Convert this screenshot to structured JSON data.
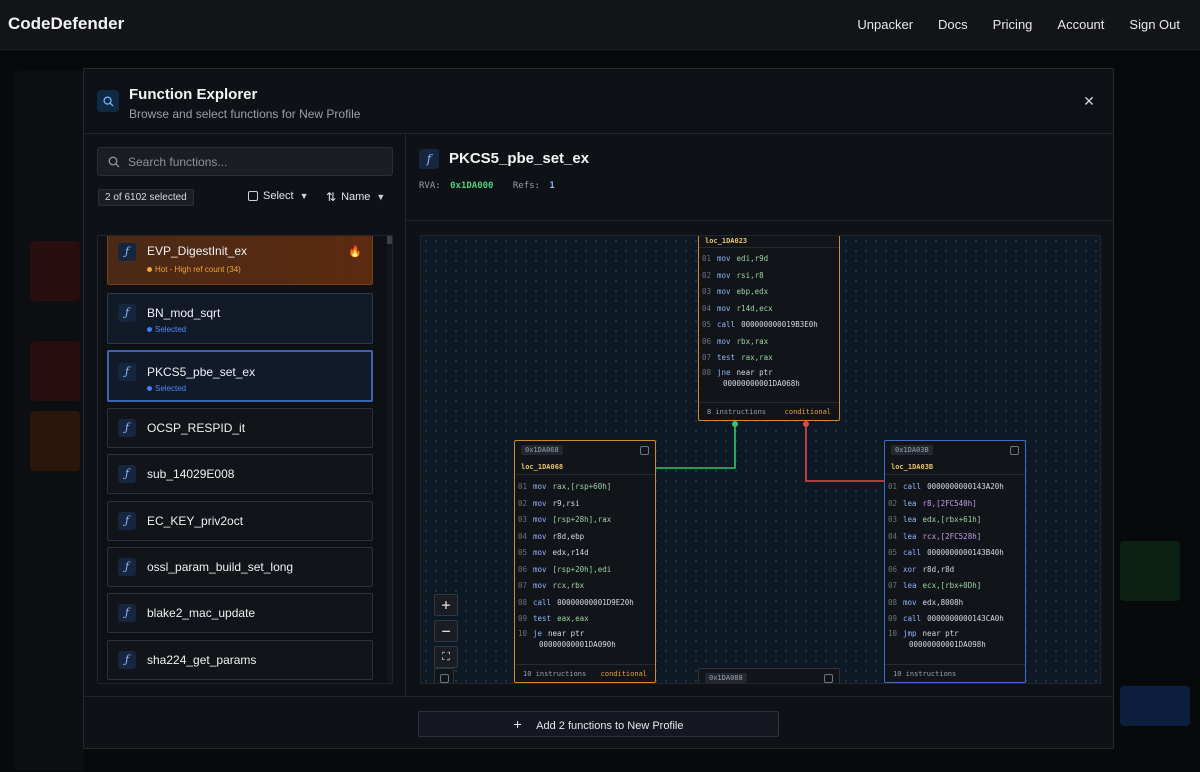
{
  "app": {
    "brand": "CodeDefender",
    "nav": [
      "Unpacker",
      "Docs",
      "Pricing",
      "Account",
      "Sign Out"
    ]
  },
  "modal": {
    "title": "Function Explorer",
    "subtitle": "Browse and select functions for New Profile",
    "close_glyph": "✕"
  },
  "left": {
    "search_placeholder": "Search functions...",
    "count": "2 of 6102 selected",
    "select_label": "Select",
    "sort_label": "Name",
    "items": [
      {
        "name": "EVP_DigestInit_ex",
        "status": "Hot - High ref count (34)",
        "kind": "hot",
        "flame": "🔥"
      },
      {
        "name": "BN_mod_sqrt",
        "status": "Selected",
        "kind": "selected"
      },
      {
        "name": "PKCS5_pbe_set_ex",
        "status": "Selected",
        "kind": "active"
      },
      {
        "name": "OCSP_RESPID_it",
        "status": "",
        "kind": "normal"
      },
      {
        "name": "sub_14029E008",
        "status": "",
        "kind": "normal"
      },
      {
        "name": "EC_KEY_priv2oct",
        "status": "",
        "kind": "normal"
      },
      {
        "name": "ossl_param_build_set_long",
        "status": "",
        "kind": "normal"
      },
      {
        "name": "blake2_mac_update",
        "status": "",
        "kind": "normal"
      },
      {
        "name": "sha224_get_params",
        "status": "",
        "kind": "normal"
      }
    ]
  },
  "right": {
    "fn_glyph": "f",
    "title": "PKCS5_pbe_set_ex",
    "rva_label": "RVA:",
    "rva": "0x1DA000",
    "refs_label": "Refs:",
    "refs": "1"
  },
  "graph": {
    "block_top": {
      "label": "loc_1DA023",
      "rows": [
        [
          "01",
          "mov",
          "edi,r9d"
        ],
        [
          "02",
          "mov",
          "rsi,r8"
        ],
        [
          "03",
          "mov",
          "ebp,edx"
        ],
        [
          "04",
          "mov",
          "r14d,ecx"
        ],
        [
          "05",
          "call",
          "000000000019B3E0h"
        ],
        [
          "06",
          "mov",
          "rbx,rax"
        ],
        [
          "07",
          "test",
          "rax,rax"
        ],
        [
          "08",
          "jne",
          "near ptr"
        ]
      ],
      "row8_extra": "00000000001DA068h",
      "count": "8 instructions",
      "tag": "conditional"
    },
    "block_left": {
      "addr": "0x1DA068",
      "label": "loc_1DA068",
      "rows": [
        [
          "01",
          "mov",
          "rax,[rsp+60h]"
        ],
        [
          "02",
          "mov",
          "r9,rsi"
        ],
        [
          "03",
          "mov",
          "[rsp+28h],rax"
        ],
        [
          "04",
          "mov",
          "r8d,ebp"
        ],
        [
          "05",
          "mov",
          "edx,r14d"
        ],
        [
          "06",
          "mov",
          "[rsp+20h],edi"
        ],
        [
          "07",
          "mov",
          "rcx,rbx"
        ],
        [
          "08",
          "call",
          "00000000001D9E20h"
        ],
        [
          "09",
          "test",
          "eax,eax"
        ],
        [
          "10",
          "je",
          "near ptr"
        ]
      ],
      "row10_extra": "00000000001DA090h",
      "count": "10 instructions",
      "tag": "conditional"
    },
    "block_right": {
      "addr": "0x1DA03B",
      "label": "loc_1DA03B",
      "rows": [
        [
          "01",
          "call",
          "0000000000143A20h"
        ],
        [
          "02",
          "lea",
          "r8,[2FC540h]"
        ],
        [
          "03",
          "lea",
          "edx,[rbx+61h]"
        ],
        [
          "04",
          "lea",
          "rcx,[2FC528h]"
        ],
        [
          "05",
          "call",
          "0000000000143B40h"
        ],
        [
          "06",
          "xor",
          "r8d,r8d"
        ],
        [
          "07",
          "lea",
          "ecx,[rbx+0Dh]"
        ],
        [
          "08",
          "mov",
          "edx,8008h"
        ],
        [
          "09",
          "call",
          "0000000000143CA0h"
        ],
        [
          "10",
          "jmp",
          "near ptr"
        ]
      ],
      "row10_extra": "00000000001DA098h",
      "count": "10 instructions"
    },
    "block_bottom": {
      "addr": "0x1DA088"
    },
    "zoom": [
      "+",
      "−",
      "⛶"
    ]
  },
  "footer": {
    "plus": "+",
    "button": "Add 2 functions to New Profile"
  },
  "colors": {
    "accent": "#3b64b0",
    "hot": "#e7a23b",
    "selected_dot": "#3b82f6",
    "true_edge": "#34c46a",
    "false_edge": "#e04848"
  }
}
